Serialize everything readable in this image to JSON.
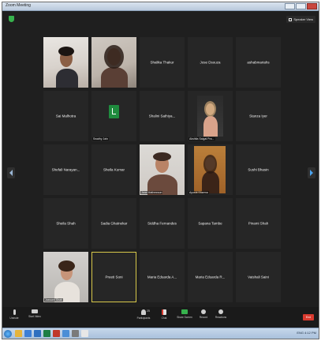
{
  "window": {
    "title": "Zoom Meeting",
    "view_button_label": "Speaker View"
  },
  "participants": [
    {
      "name": "",
      "label": "",
      "video": "room1"
    },
    {
      "name": "",
      "label": "",
      "video": "room2"
    },
    {
      "name": "Shalika Thakur",
      "label": "",
      "video": ""
    },
    {
      "name": "Jose Dsouza",
      "label": "",
      "video": ""
    },
    {
      "name": "ashabmariahs",
      "label": "",
      "video": ""
    },
    {
      "name": "Sai Malhotra",
      "label": "",
      "video": ""
    },
    {
      "name": "",
      "label": "Swathy Jain",
      "video": "logo"
    },
    {
      "name": "Shalini Sathiya...",
      "label": "",
      "video": ""
    },
    {
      "name": "",
      "label": "Akshita Saigal Pra...",
      "video": "room4"
    },
    {
      "name": "Stanza Iyer",
      "label": "",
      "video": ""
    },
    {
      "name": "Shefali Narayan...",
      "label": "",
      "video": ""
    },
    {
      "name": "Sheila Kumar",
      "label": "",
      "video": ""
    },
    {
      "name": "",
      "label": "Jane Mathewson",
      "video": "room3"
    },
    {
      "name": "",
      "label": "Ayushi Sharma",
      "video": "room5"
    },
    {
      "name": "Sushi Bhasin",
      "label": "",
      "video": ""
    },
    {
      "name": "Sheila Shah",
      "label": "",
      "video": ""
    },
    {
      "name": "Sadia Ghatnekar",
      "label": "",
      "video": ""
    },
    {
      "name": "Siddha Fernandes",
      "label": "",
      "video": ""
    },
    {
      "name": "Sapana Tambe",
      "label": "",
      "video": ""
    },
    {
      "name": "Pinami Shah",
      "label": "",
      "video": ""
    },
    {
      "name": "",
      "label": "Jaswant Shah",
      "video": "room6"
    },
    {
      "name": "Preeti Soni",
      "label": "",
      "video": "",
      "selected": true
    },
    {
      "name": "Maria Eduarda A...",
      "label": "",
      "video": ""
    },
    {
      "name": "Maria Eduarda R...",
      "label": "",
      "video": ""
    },
    {
      "name": "Vaishali Saini",
      "label": "",
      "video": ""
    }
  ],
  "toolbar": {
    "unmute": "Unmute",
    "start_video": "Start Video",
    "participants": "Participants",
    "participant_count": "25",
    "chat": "Chat",
    "share_screen": "Share Screen",
    "record": "Record",
    "reactions": "Reactions",
    "end": "End"
  },
  "taskbar": {
    "clock": "ENG 4:12 PM"
  },
  "colors": {
    "meeting_bg": "#1f1f1f",
    "tile_bg": "#262626",
    "selected_border": "#d7c84a",
    "share_green": "#37b24d",
    "end_red": "#d93a2f"
  },
  "icons": [
    "shield-icon",
    "grid-view-icon",
    "microphone-icon",
    "camera-icon",
    "participants-icon",
    "chat-icon",
    "share-screen-icon",
    "record-icon",
    "reactions-icon",
    "arrow-left-icon",
    "arrow-right-icon",
    "start-icon"
  ]
}
